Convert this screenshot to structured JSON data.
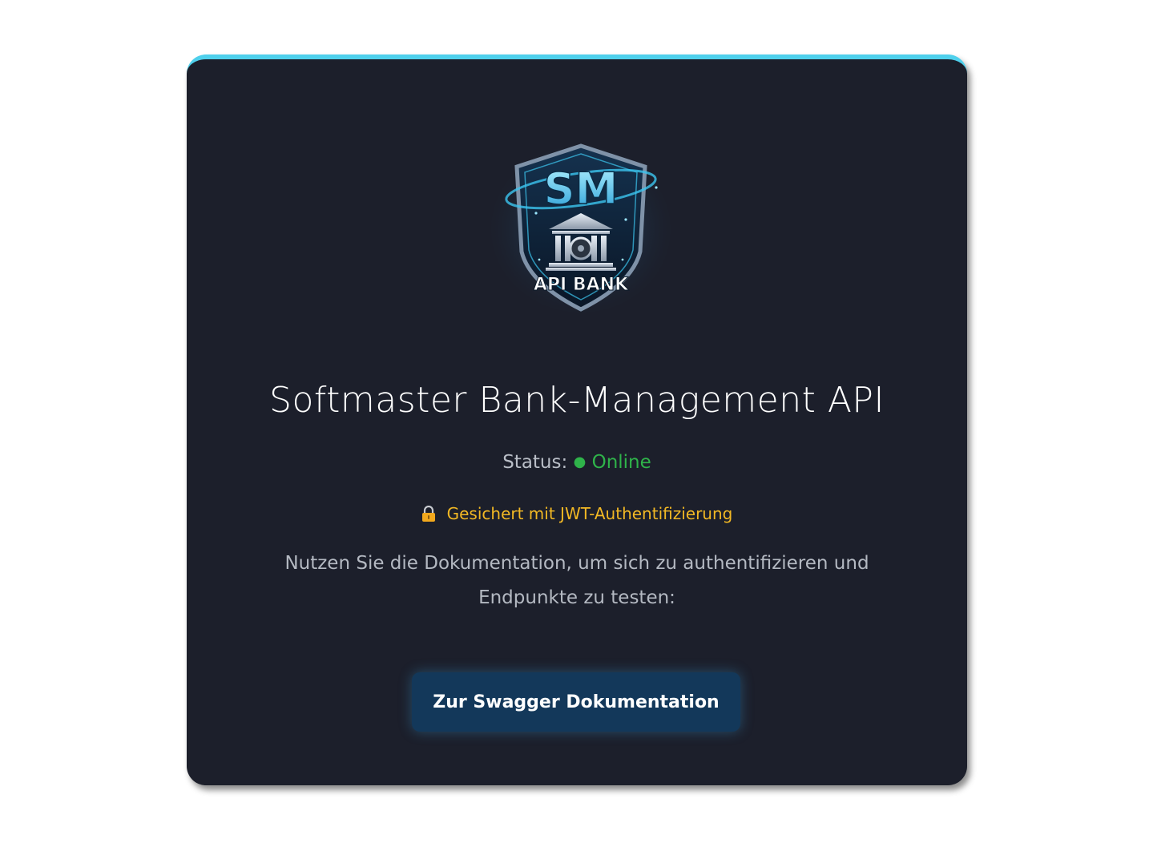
{
  "logo": {
    "monogram": "SM",
    "label": "API BANK"
  },
  "title": "Softmaster Bank-Management API",
  "status": {
    "label": "Status:",
    "dot": "●",
    "value": "Online"
  },
  "security": {
    "icon": "lock-icon",
    "text": "Gesichert mit JWT-Authentifizierung"
  },
  "description": "Nutzen Sie die Dokumentation, um sich zu authentifizieren und Endpunkte zu testen:",
  "button": {
    "label": "Zur Swagger Dokumentation"
  },
  "colors": {
    "card_background": "#1c1f2b",
    "accent_top": "#4fd0ec",
    "online": "#2fb34a",
    "security_text": "#f2b824",
    "button_background": "#13385a"
  }
}
